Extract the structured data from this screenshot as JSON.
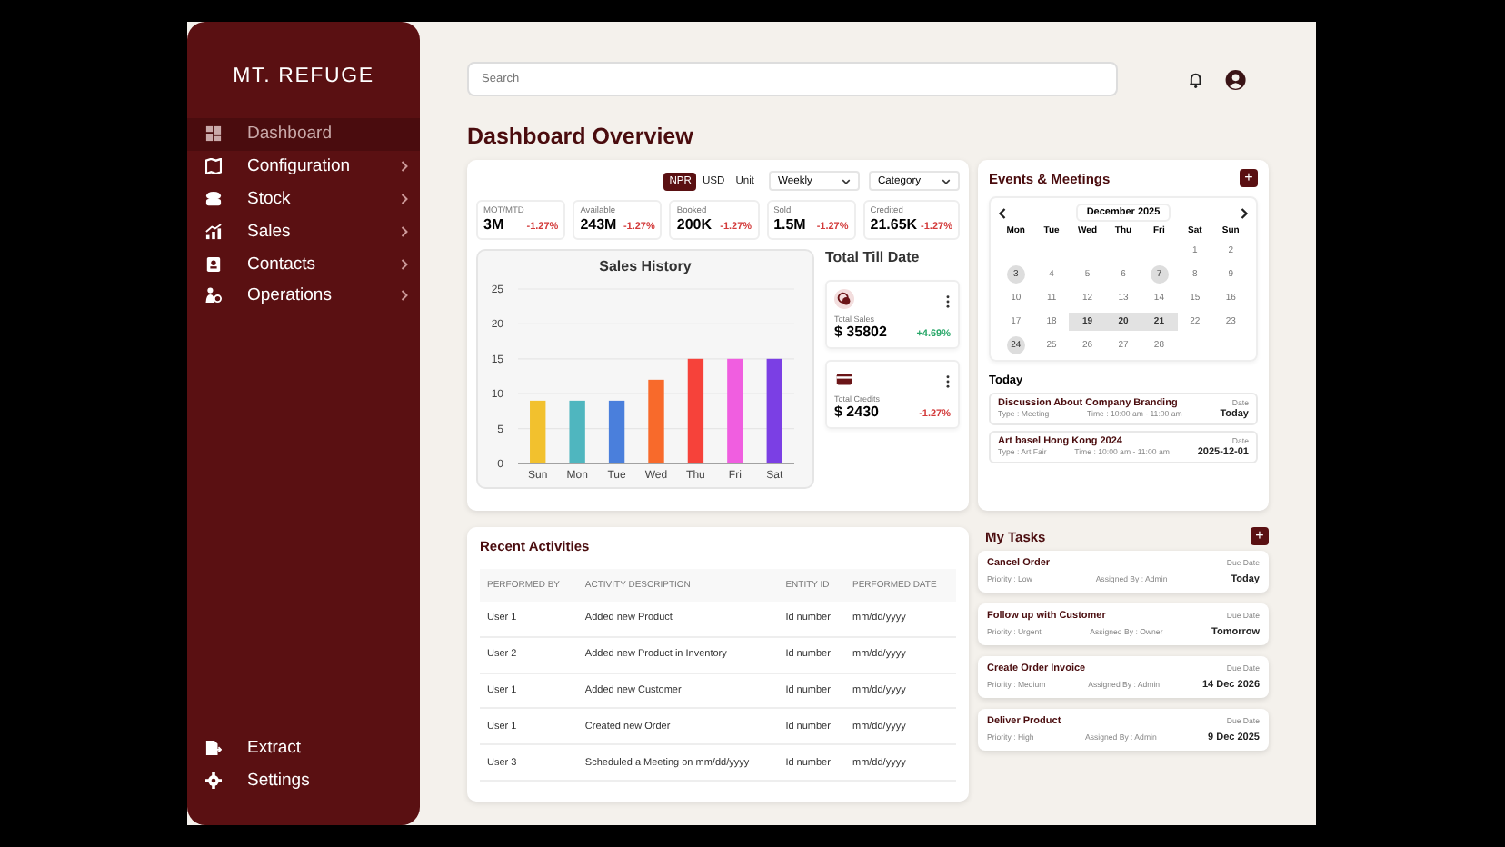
{
  "brand": "MT. REFUGE",
  "nav": [
    {
      "label": "Dashboard",
      "kind": "grid",
      "selected": true,
      "submenu": false
    },
    {
      "label": "Configuration",
      "kind": "map",
      "selected": false,
      "submenu": true
    },
    {
      "label": "Stock",
      "kind": "box",
      "selected": false,
      "submenu": true
    },
    {
      "label": "Sales",
      "kind": "chart",
      "selected": false,
      "submenu": true
    },
    {
      "label": "Contacts",
      "kind": "contact",
      "selected": false,
      "submenu": true
    },
    {
      "label": "Operations",
      "kind": "people",
      "selected": false,
      "submenu": true
    }
  ],
  "nav_bottom": [
    {
      "label": "Extract",
      "kind": "export"
    },
    {
      "label": "Settings",
      "kind": "gear"
    }
  ],
  "search": {
    "placeholder": "Search"
  },
  "page_title": "Dashboard Overview",
  "unit_toggle": [
    {
      "label": "NPR",
      "selected": true
    },
    {
      "label": "USD",
      "selected": false
    },
    {
      "label": "Unit",
      "selected": false
    }
  ],
  "dropdowns": [
    "Weekly",
    "Category"
  ],
  "metrics": [
    {
      "label": "MOT/MTD",
      "value": "3M",
      "change": "-1.27%",
      "color": "#d33a3a"
    },
    {
      "label": "Available",
      "value": "243M",
      "change": "-1.27%",
      "color": "#d33a3a"
    },
    {
      "label": "Booked",
      "value": "200K",
      "change": "-1.27%",
      "color": "#d33a3a"
    },
    {
      "label": "Sold",
      "value": "1.5M",
      "change": "-1.27%",
      "color": "#d33a3a"
    },
    {
      "label": "Credited",
      "value": "21.65K",
      "change": "-1.27%",
      "color": "#d33a3a"
    }
  ],
  "sales_history": {
    "title": "Sales History",
    "chart_data": {
      "type": "bar",
      "categories": [
        "Sun",
        "Mon",
        "Tue",
        "Wed",
        "Thu",
        "Fri",
        "Sat"
      ],
      "ylim": [
        0,
        25
      ],
      "yticks": [
        0,
        5,
        10,
        15,
        20,
        25
      ],
      "grid": true,
      "values": [
        9,
        9,
        9,
        12,
        15,
        15,
        15
      ]
    }
  },
  "total_till_date": {
    "title": "Total Till Date",
    "cards": [
      {
        "kind": "coin",
        "label": "Total Sales",
        "value": "$ 35802",
        "change": "+4.69%",
        "color": "#2aa86a"
      },
      {
        "kind": "card",
        "label": "Total Credits",
        "value": "$ 2430",
        "change": "-1.27%",
        "color": "#d33a3a"
      }
    ]
  },
  "events": {
    "title": "Events & Meetings",
    "add": "+",
    "calendar": {
      "month": "December 2025",
      "weekdays": [
        "Mon",
        "Tue",
        "Wed",
        "Thu",
        "Fri",
        "Sat",
        "Sun"
      ],
      "weeks": [
        [
          {
            "kind": "blank"
          },
          {
            "kind": "blank"
          },
          {
            "kind": "blank"
          },
          {
            "kind": "blank"
          },
          {
            "kind": "blank"
          },
          {
            "label": "1",
            "kind": "plain"
          },
          {
            "label": "2",
            "kind": "plain"
          }
        ],
        [
          {
            "label": "3",
            "kind": "circle"
          },
          {
            "label": "4",
            "kind": "plain"
          },
          {
            "label": "5",
            "kind": "plain"
          },
          {
            "label": "6",
            "kind": "plain"
          },
          {
            "label": "7",
            "kind": "circle"
          },
          {
            "label": "8",
            "kind": "plain"
          },
          {
            "label": "9",
            "kind": "plain"
          }
        ],
        [
          {
            "label": "10",
            "kind": "plain"
          },
          {
            "label": "11",
            "kind": "plain"
          },
          {
            "label": "12",
            "kind": "plain"
          },
          {
            "label": "13",
            "kind": "plain"
          },
          {
            "label": "14",
            "kind": "plain"
          },
          {
            "label": "15",
            "kind": "plain"
          },
          {
            "label": "16",
            "kind": "plain"
          }
        ],
        [
          {
            "label": "17",
            "kind": "plain"
          },
          {
            "label": "18",
            "kind": "plain"
          },
          {
            "label": "19",
            "kind": "range"
          },
          {
            "label": "20",
            "kind": "range"
          },
          {
            "label": "21",
            "kind": "range"
          },
          {
            "label": "22",
            "kind": "plain"
          },
          {
            "label": "23",
            "kind": "plain"
          }
        ],
        [
          {
            "label": "24",
            "kind": "circle"
          },
          {
            "label": "25",
            "kind": "plain"
          },
          {
            "label": "26",
            "kind": "plain"
          },
          {
            "label": "27",
            "kind": "plain"
          },
          {
            "label": "28",
            "kind": "plain"
          },
          {
            "kind": "blank"
          },
          {
            "kind": "blank"
          }
        ]
      ]
    },
    "today_title": "Today",
    "items": [
      {
        "title": "Discussion About Company Branding",
        "type": "Type : Meeting",
        "time": "Time : 10:00 am - 11:00 am",
        "date_label": "Date",
        "date": "Today"
      },
      {
        "title": "Art basel Hong Kong 2024",
        "type": "Type : Art Fair",
        "time": "Time : 10:00 am - 11:00 am",
        "date_label": "Date",
        "date": "2025-12-01"
      }
    ]
  },
  "activities": {
    "title": "Recent Activities",
    "columns": [
      "PERFORMED BY",
      "ACTIVITY DESCRIPTION",
      "ENTITY ID",
      "PERFORMED DATE"
    ],
    "rows": [
      [
        "User 1",
        "Added new Product",
        "Id number",
        "mm/dd/yyyy"
      ],
      [
        "User 2",
        "Added new Product in Inventory",
        "Id number",
        "mm/dd/yyyy"
      ],
      [
        "User 1",
        "Added new Customer",
        "Id number",
        "mm/dd/yyyy"
      ],
      [
        "User 1",
        "Created new Order",
        "Id number",
        "mm/dd/yyyy"
      ],
      [
        "User 3",
        "Scheduled a Meeting on mm/dd/yyyy",
        "Id number",
        "mm/dd/yyyy"
      ]
    ]
  },
  "tasks": {
    "title": "My Tasks",
    "add": "+",
    "items": [
      {
        "title": "Cancel Order",
        "priority": "Priority : Low",
        "assigned": "Assigned By : Admin",
        "due_label": "Due Date",
        "due": "Today"
      },
      {
        "title": "Follow up with Customer",
        "priority": "Priority : Urgent",
        "assigned": "Assigned By : Owner",
        "due_label": "Due Date",
        "due": "Tomorrow"
      },
      {
        "title": "Create Order Invoice",
        "priority": "Priority : Medium",
        "assigned": "Assigned By : Admin",
        "due_label": "Due Date",
        "due": "14 Dec 2026"
      },
      {
        "title": "Deliver Product",
        "priority": "Priority : High",
        "assigned": "Assigned By : Admin",
        "due_label": "Due Date",
        "due": "9 Dec 2025"
      }
    ]
  }
}
